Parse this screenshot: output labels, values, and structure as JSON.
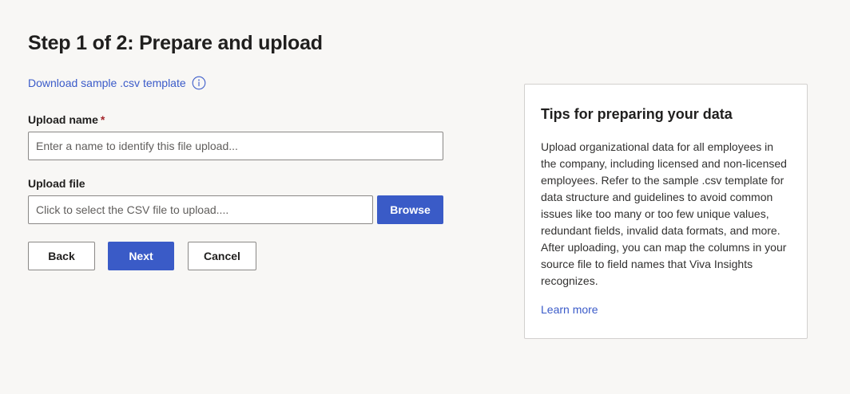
{
  "header": {
    "title": "Step 1 of 2: Prepare and upload"
  },
  "download": {
    "link_label": "Download sample .csv template",
    "info_icon": "info-icon"
  },
  "form": {
    "upload_name": {
      "label": "Upload name",
      "required_marker": "*",
      "placeholder": "Enter a name to identify this file upload..."
    },
    "upload_file": {
      "label": "Upload file",
      "placeholder": "Click to select the CSV file to upload....",
      "browse_label": "Browse"
    }
  },
  "actions": {
    "back_label": "Back",
    "next_label": "Next",
    "cancel_label": "Cancel"
  },
  "tips": {
    "title": "Tips for preparing your data",
    "body": "Upload organizational data for all employees in the company, including licensed and non-licensed employees. Refer to the sample .csv template for data structure and guidelines to avoid common issues like too many or too few unique values, redundant fields, invalid data formats, and more. After uploading, you can map the columns in your source file to field names that Viva Insights recognizes.",
    "learn_more_label": "Learn more"
  },
  "colors": {
    "accent": "#3a5bc7",
    "link": "#3b5bc9",
    "required": "#a4262c",
    "background": "#f8f7f5"
  }
}
